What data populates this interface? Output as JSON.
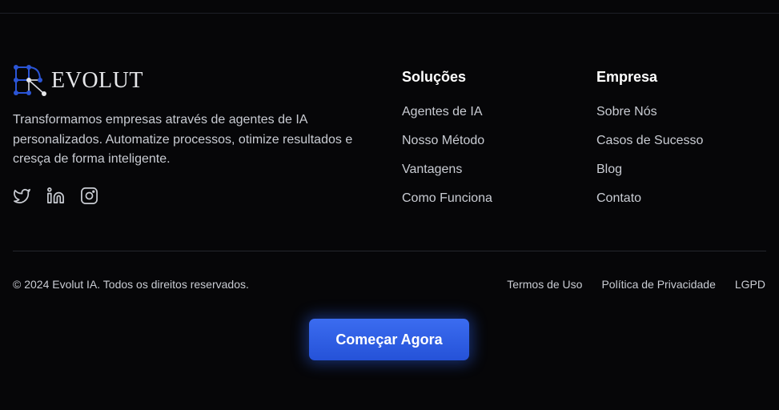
{
  "brand": {
    "name": "EVOLUT"
  },
  "tagline": "Transformamos empresas através de agentes de IA personalizados. Automatize processos, otimize resultados e cresça de forma inteligente.",
  "socials": [
    {
      "icon": "twitter-icon"
    },
    {
      "icon": "linkedin-icon"
    },
    {
      "icon": "instagram-icon"
    }
  ],
  "columns": {
    "solucoes": {
      "title": "Soluções",
      "links": [
        "Agentes de IA",
        "Nosso Método",
        "Vantagens",
        "Como Funciona"
      ]
    },
    "empresa": {
      "title": "Empresa",
      "links": [
        "Sobre Nós",
        "Casos de Sucesso",
        "Blog",
        "Contato"
      ]
    }
  },
  "footer": {
    "copyright": "© 2024 Evolut IA. Todos os direitos reservados.",
    "legal": [
      "Termos de Uso",
      "Política de Privacidade",
      "LGPD"
    ]
  },
  "cta": {
    "label": "Começar Agora"
  },
  "colors": {
    "background": "#060608",
    "accent": "#2f5fe6",
    "text": "#c9ccd3",
    "heading": "#ffffff"
  }
}
